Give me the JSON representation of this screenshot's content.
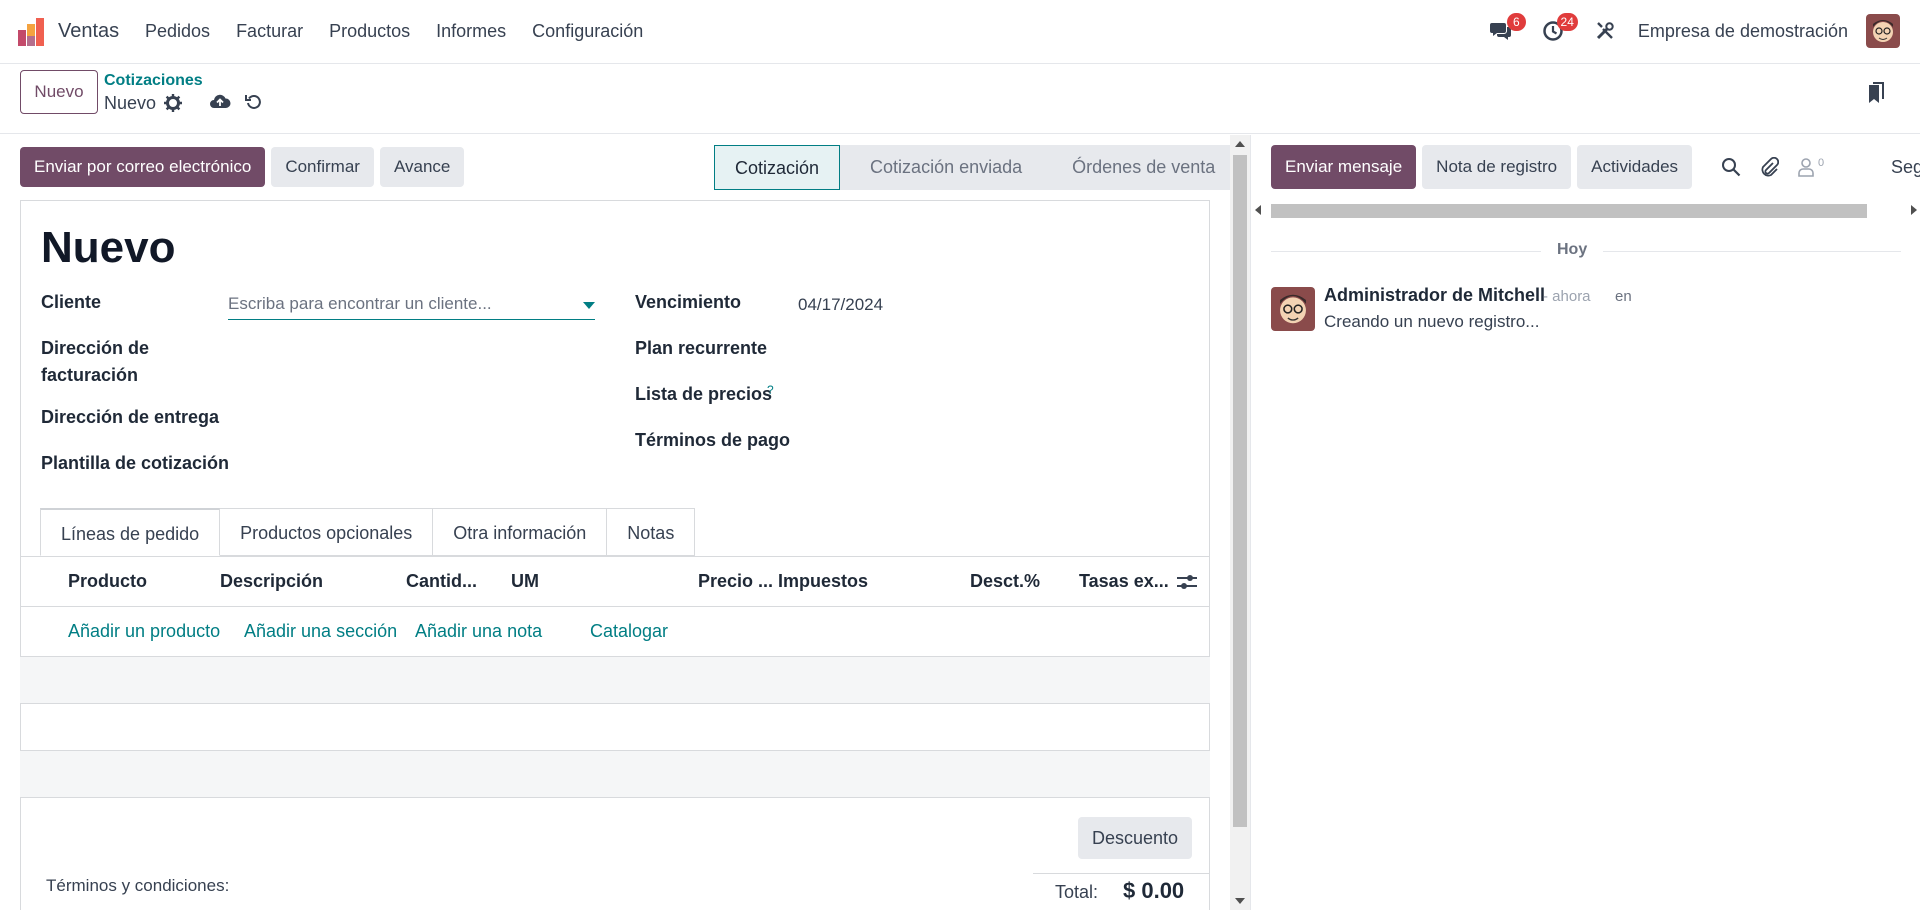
{
  "navbar": {
    "app_name": "Ventas",
    "menu": [
      "Pedidos",
      "Facturar",
      "Productos",
      "Informes",
      "Configuración"
    ],
    "messages_count": "6",
    "activities_count": "24",
    "company": "Empresa de demostración"
  },
  "control": {
    "new_button": "Nuevo",
    "breadcrumb": "Cotizaciones",
    "record_name": "Nuevo"
  },
  "actions": {
    "send_email": "Enviar por correo electrónico",
    "confirm": "Confirmar",
    "progress": "Avance"
  },
  "stages": {
    "items": [
      "Cotización",
      "Cotización enviada",
      "Órdenes de venta"
    ],
    "active": "Cotización"
  },
  "form": {
    "title": "Nuevo",
    "customer_label": "Cliente",
    "customer_placeholder": "Escriba para encontrar un cliente...",
    "invoice_address_label_1": "Dirección de",
    "invoice_address_label_2": "facturación",
    "delivery_address_label": "Dirección de entrega",
    "quote_template_label": "Plantilla de cotización",
    "expiration_label": "Vencimiento",
    "expiration_value": "04/17/2024",
    "recurring_plan_label": "Plan recurrente",
    "pricelist_label": "Lista de precios",
    "pricelist_help": "?",
    "payment_terms_label": "Términos de pago"
  },
  "tabs": [
    "Líneas de pedido",
    "Productos opcionales",
    "Otra información",
    "Notas"
  ],
  "lines": {
    "columns": [
      "Producto",
      "Descripción",
      "Cantid...",
      "UM",
      "Precio ...",
      "Impuestos",
      "Desct.%",
      "Tasas ex..."
    ],
    "add_links": [
      "Añadir un producto",
      "Añadir una sección",
      "Añadir una nota",
      "Catalogar"
    ]
  },
  "footer": {
    "discount_button": "Descuento",
    "terms": "Términos y condiciones:",
    "total_label": "Total:",
    "total_value": "$ 0.00"
  },
  "chatter": {
    "send_message": "Enviar mensaje",
    "log_note": "Nota de registro",
    "activities": "Actividades",
    "followers_count": "0",
    "follow_label": "Segu",
    "day_label": "Hoy",
    "message": {
      "author": "Administrador de Mitchell",
      "time": "- ahora",
      "in": "en",
      "body": "Creando un nuevo registro..."
    }
  },
  "colors": {
    "primary": "#714B67",
    "link": "#017e84",
    "badge": "#e03c3c"
  }
}
